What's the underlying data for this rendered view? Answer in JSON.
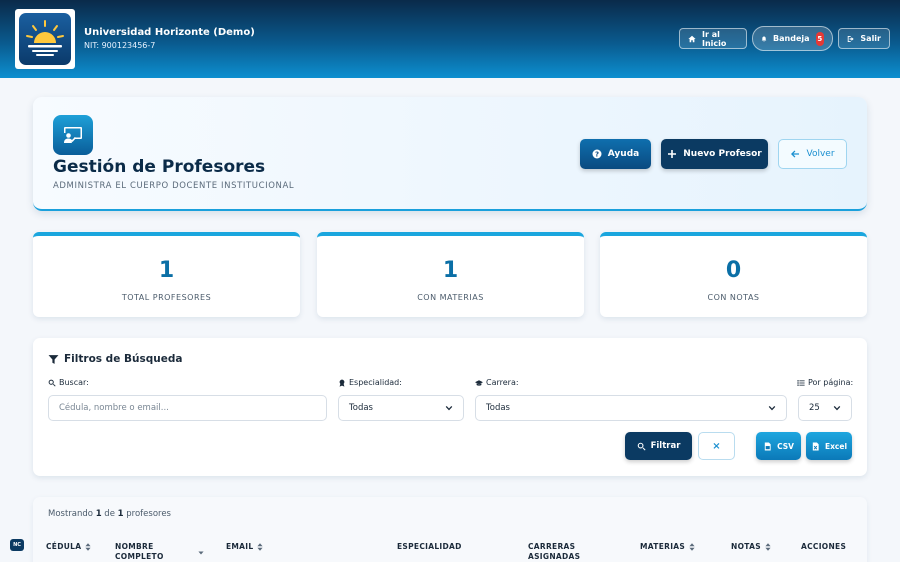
{
  "topbar": {
    "org_name": "Universidad Horizonte (Demo)",
    "nit": "NIT: 900123456-7",
    "inicio_label": "Ir al Inicio",
    "bandeja_label": "Bandeja",
    "bandeja_count": "5",
    "salir_label": "Salir"
  },
  "header": {
    "title": "Gestión de Profesores",
    "subtitle": "ADMINISTRA EL CUERPO DOCENTE INSTITUCIONAL",
    "ayuda_label": "Ayuda",
    "nuevo_label": "Nuevo Profesor",
    "volver_label": "Volver"
  },
  "stats": [
    {
      "value": "1",
      "label": "TOTAL PROFESORES"
    },
    {
      "value": "1",
      "label": "CON MATERIAS"
    },
    {
      "value": "0",
      "label": "CON NOTAS"
    }
  ],
  "filters": {
    "title": "Filtros de Búsqueda",
    "buscar_label": "Buscar:",
    "buscar_placeholder": "Cédula, nombre o email...",
    "especialidad_label": "Especialidad:",
    "especialidad_value": "Todas",
    "carrera_label": "Carrera:",
    "carrera_value": "Todas",
    "por_pagina_label": "Por página:",
    "por_pagina_value": "25",
    "filtrar_label": "Filtrar",
    "clear_label": "×",
    "csv_label": "CSV",
    "excel_label": "Excel"
  },
  "table": {
    "showing_prefix": "Mostrando ",
    "showing_from": "1",
    "showing_mid": " de ",
    "showing_total": "1",
    "showing_suffix": " profesores",
    "headers": {
      "cedula": "CÉDULA",
      "nombre_1": "NOMBRE",
      "nombre_2": "COMPLETO",
      "email": "EMAIL",
      "especialidad": "ESPECIALIDAD",
      "carreras_1": "CARRERAS",
      "carreras_2": "ASIGNADAS",
      "materias": "MATERIAS",
      "notas": "NOTAS",
      "acciones": "ACCIONES"
    }
  },
  "footer_badge": "NC"
}
